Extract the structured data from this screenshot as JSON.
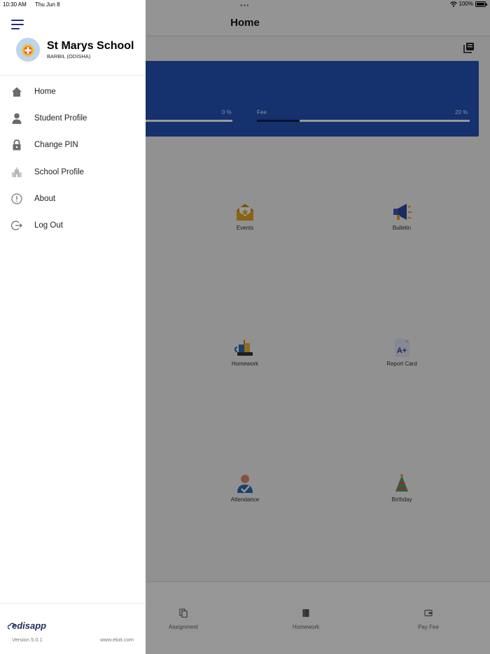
{
  "status_bar": {
    "time": "10:30 AM",
    "date": "Thu Jun 8",
    "battery": "100%"
  },
  "app": {
    "title": "Home",
    "progress": [
      {
        "label": "",
        "value_text": "0 %",
        "fraction": 0.0
      },
      {
        "label": "Fee",
        "value_text": "20 %",
        "fraction": 0.2
      }
    ],
    "tiles": [
      {
        "label": "Events",
        "icon": "events-icon"
      },
      {
        "label": "Bulletin",
        "icon": "megaphone-icon"
      },
      {
        "label": "Homework",
        "icon": "homework-icon"
      },
      {
        "label": "Report Card",
        "icon": "report-card-icon"
      },
      {
        "label": "Attendance",
        "icon": "attendance-icon"
      },
      {
        "label": "Birthday",
        "icon": "birthday-icon"
      }
    ],
    "bottom_nav": [
      {
        "label": "Assignment",
        "icon": "assignment-icon"
      },
      {
        "label": "Homework",
        "icon": "book-icon"
      },
      {
        "label": "Pay Fee",
        "icon": "wallet-icon"
      }
    ]
  },
  "drawer": {
    "school_name": "St Marys School",
    "school_location": "BARBIL (ODISHA)",
    "items": [
      {
        "label": "Home",
        "icon": "home-icon"
      },
      {
        "label": "Student Profile",
        "icon": "person-icon"
      },
      {
        "label": "Change PIN",
        "icon": "lock-icon"
      },
      {
        "label": "School Profile",
        "icon": "school-icon"
      },
      {
        "label": "About",
        "icon": "info-icon"
      },
      {
        "label": "Log Out",
        "icon": "logout-icon"
      }
    ],
    "footer": {
      "brand": "edisapp",
      "version": "Version 5.0.1",
      "website": "www.eloit.com"
    }
  },
  "colors": {
    "accent": "#2452b7",
    "menu_icon": "#25307a",
    "overlay": "rgba(0,0,0,0.4)"
  }
}
